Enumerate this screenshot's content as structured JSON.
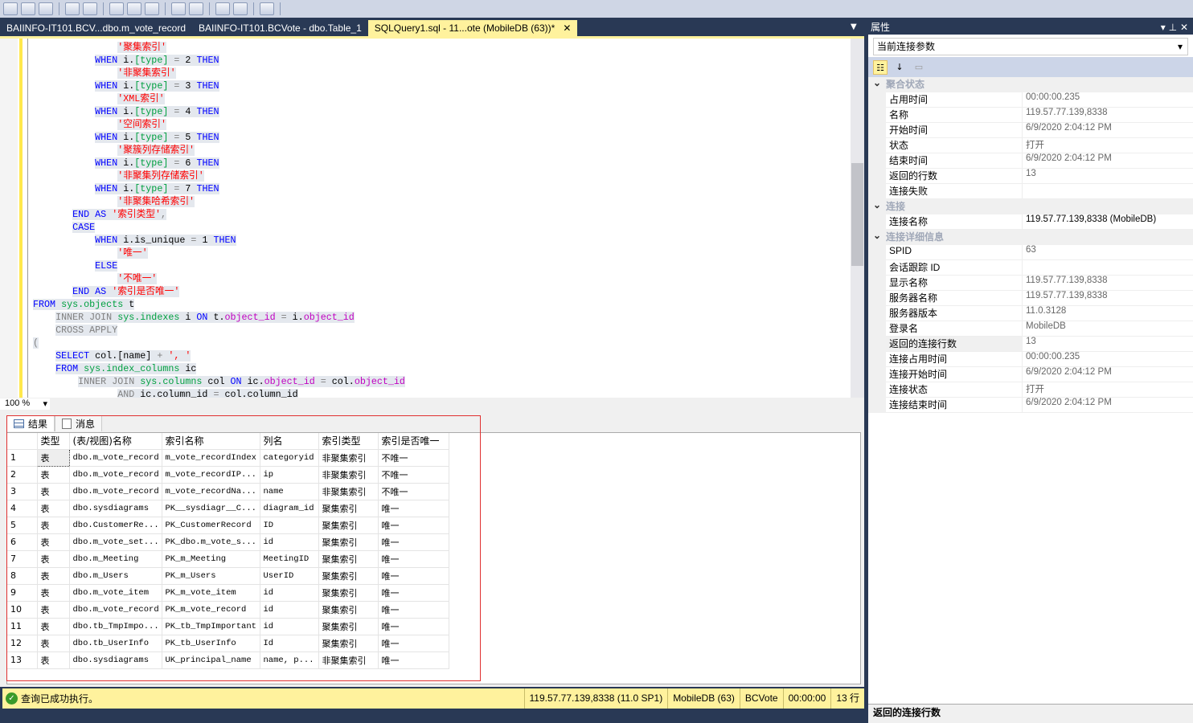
{
  "tabs": [
    {
      "label": "BAIINFO-IT101.BCV...dbo.m_vote_record"
    },
    {
      "label": "BAIINFO-IT101.BCVote - dbo.Table_1"
    },
    {
      "label": "SQLQuery1.sql - 11...ote (MobileDB (63))*",
      "active": true
    }
  ],
  "code": [
    [
      [
        "               ",
        "pl"
      ],
      [
        "'聚集索引'",
        "str"
      ]
    ],
    [
      [
        "           ",
        "pl"
      ],
      [
        "WHEN ",
        "kw"
      ],
      [
        "i.",
        "pl"
      ],
      [
        "[type]",
        "col2"
      ],
      [
        " = ",
        "gray"
      ],
      [
        "2 ",
        "num"
      ],
      [
        "THEN",
        "kw"
      ]
    ],
    [
      [
        "               ",
        "pl"
      ],
      [
        "'非聚集索引'",
        "str"
      ]
    ],
    [
      [
        "           ",
        "pl"
      ],
      [
        "WHEN ",
        "kw"
      ],
      [
        "i.",
        "pl"
      ],
      [
        "[type]",
        "col2"
      ],
      [
        " = ",
        "gray"
      ],
      [
        "3 ",
        "num"
      ],
      [
        "THEN",
        "kw"
      ]
    ],
    [
      [
        "               ",
        "pl"
      ],
      [
        "'XML索引'",
        "str"
      ]
    ],
    [
      [
        "           ",
        "pl"
      ],
      [
        "WHEN ",
        "kw"
      ],
      [
        "i.",
        "pl"
      ],
      [
        "[type]",
        "col2"
      ],
      [
        " = ",
        "gray"
      ],
      [
        "4 ",
        "num"
      ],
      [
        "THEN",
        "kw"
      ]
    ],
    [
      [
        "               ",
        "pl"
      ],
      [
        "'空间索引'",
        "str"
      ]
    ],
    [
      [
        "           ",
        "pl"
      ],
      [
        "WHEN ",
        "kw"
      ],
      [
        "i.",
        "pl"
      ],
      [
        "[type]",
        "col2"
      ],
      [
        " = ",
        "gray"
      ],
      [
        "5 ",
        "num"
      ],
      [
        "THEN",
        "kw"
      ]
    ],
    [
      [
        "               ",
        "pl"
      ],
      [
        "'聚簇列存储索引'",
        "str"
      ]
    ],
    [
      [
        "           ",
        "pl"
      ],
      [
        "WHEN ",
        "kw"
      ],
      [
        "i.",
        "pl"
      ],
      [
        "[type]",
        "col2"
      ],
      [
        " = ",
        "gray"
      ],
      [
        "6 ",
        "num"
      ],
      [
        "THEN",
        "kw"
      ]
    ],
    [
      [
        "               ",
        "pl"
      ],
      [
        "'非聚集列存储索引'",
        "str"
      ]
    ],
    [
      [
        "           ",
        "pl"
      ],
      [
        "WHEN ",
        "kw"
      ],
      [
        "i.",
        "pl"
      ],
      [
        "[type]",
        "col2"
      ],
      [
        " = ",
        "gray"
      ],
      [
        "7 ",
        "num"
      ],
      [
        "THEN",
        "kw"
      ]
    ],
    [
      [
        "               ",
        "pl"
      ],
      [
        "'非聚集哈希索引'",
        "str"
      ]
    ],
    [
      [
        "       ",
        "pl"
      ],
      [
        "END AS ",
        "kw"
      ],
      [
        "'索引类型'",
        "str"
      ],
      [
        ",",
        "gray"
      ]
    ],
    [
      [
        "       ",
        "pl"
      ],
      [
        "CASE",
        "kw"
      ]
    ],
    [
      [
        "           ",
        "pl"
      ],
      [
        "WHEN ",
        "kw"
      ],
      [
        "i.is_unique",
        "pl"
      ],
      [
        " = ",
        "gray"
      ],
      [
        "1 ",
        "num"
      ],
      [
        "THEN",
        "kw"
      ]
    ],
    [
      [
        "               ",
        "pl"
      ],
      [
        "'唯一'",
        "str"
      ]
    ],
    [
      [
        "           ",
        "pl"
      ],
      [
        "ELSE",
        "kw"
      ]
    ],
    [
      [
        "               ",
        "pl"
      ],
      [
        "'不唯一'",
        "str"
      ]
    ],
    [
      [
        "       ",
        "pl"
      ],
      [
        "END AS ",
        "kw"
      ],
      [
        "'索引是否唯一'",
        "str"
      ]
    ],
    [
      [
        "FROM ",
        "kw"
      ],
      [
        "sys.objects",
        "sys"
      ],
      [
        " t",
        "pl"
      ]
    ],
    [
      [
        "    ",
        "pl"
      ],
      [
        "INNER JOIN ",
        "gray"
      ],
      [
        "sys.indexes",
        "sys"
      ],
      [
        " i ",
        "pl"
      ],
      [
        "ON ",
        "kw"
      ],
      [
        "t.",
        "pl"
      ],
      [
        "object_id",
        "col"
      ],
      [
        " = ",
        "gray"
      ],
      [
        "i.",
        "pl"
      ],
      [
        "object_id",
        "col"
      ]
    ],
    [
      [
        "    ",
        "pl"
      ],
      [
        "CROSS APPLY",
        "gray"
      ]
    ],
    [
      [
        "(",
        "gray"
      ]
    ],
    [
      [
        "    ",
        "pl"
      ],
      [
        "SELECT ",
        "kw"
      ],
      [
        "col.",
        "pl"
      ],
      [
        "[name]",
        "pl"
      ],
      [
        " + ",
        "gray"
      ],
      [
        "', '",
        "str"
      ]
    ],
    [
      [
        "    ",
        "pl"
      ],
      [
        "FROM ",
        "kw"
      ],
      [
        "sys.index_columns",
        "sys"
      ],
      [
        " ic",
        "pl"
      ]
    ],
    [
      [
        "        ",
        "pl"
      ],
      [
        "INNER JOIN ",
        "gray"
      ],
      [
        "sys.columns",
        "sys"
      ],
      [
        " col ",
        "pl"
      ],
      [
        "ON ",
        "kw"
      ],
      [
        "ic.",
        "pl"
      ],
      [
        "object_id",
        "col"
      ],
      [
        " = ",
        "gray"
      ],
      [
        "col.",
        "pl"
      ],
      [
        "object_id",
        "col"
      ]
    ],
    [
      [
        "               ",
        "pl"
      ],
      [
        "AND ",
        "gray"
      ],
      [
        "ic.column_id",
        "pl"
      ],
      [
        " = ",
        "gray"
      ],
      [
        "col.column_id",
        "pl"
      ]
    ]
  ],
  "editor": {
    "zoom": "100 %"
  },
  "results": {
    "tabs": [
      {
        "label": "结果",
        "icon": "grid-icon"
      },
      {
        "label": "消息",
        "icon": "message-icon"
      }
    ],
    "columns": [
      "类型",
      "(表/视图)名称",
      "索引名称",
      "列名",
      "索引类型",
      "索引是否唯一"
    ],
    "rows": [
      [
        "1",
        "表",
        "dbo.m_vote_record",
        "m_vote_recordIndex",
        "categoryid",
        "非聚集索引",
        "不唯一"
      ],
      [
        "2",
        "表",
        "dbo.m_vote_record",
        "m_vote_recordIP...",
        "ip",
        "非聚集索引",
        "不唯一"
      ],
      [
        "3",
        "表",
        "dbo.m_vote_record",
        "m_vote_recordNa...",
        "name",
        "非聚集索引",
        "不唯一"
      ],
      [
        "4",
        "表",
        "dbo.sysdiagrams",
        "PK__sysdiagr__C...",
        "diagram_id",
        "聚集索引",
        "唯一"
      ],
      [
        "5",
        "表",
        "dbo.CustomerRe...",
        "PK_CustomerRecord",
        "ID",
        "聚集索引",
        "唯一"
      ],
      [
        "6",
        "表",
        "dbo.m_vote_set...",
        "PK_dbo.m_vote_s...",
        "id",
        "聚集索引",
        "唯一"
      ],
      [
        "7",
        "表",
        "dbo.m_Meeting",
        "PK_m_Meeting",
        "MeetingID",
        "聚集索引",
        "唯一"
      ],
      [
        "8",
        "表",
        "dbo.m_Users",
        "PK_m_Users",
        "UserID",
        "聚集索引",
        "唯一"
      ],
      [
        "9",
        "表",
        "dbo.m_vote_item",
        "PK_m_vote_item",
        "id",
        "聚集索引",
        "唯一"
      ],
      [
        "10",
        "表",
        "dbo.m_vote_record",
        "PK_m_vote_record",
        "id",
        "聚集索引",
        "唯一"
      ],
      [
        "11",
        "表",
        "dbo.tb_TmpImpo...",
        "PK_tb_TmpImportant",
        "id",
        "聚集索引",
        "唯一"
      ],
      [
        "12",
        "表",
        "dbo.tb_UserInfo",
        "PK_tb_UserInfo",
        "Id",
        "聚集索引",
        "唯一"
      ],
      [
        "13",
        "表",
        "dbo.sysdiagrams",
        "UK_principal_name",
        "name, p...",
        "非聚集索引",
        "唯一"
      ]
    ]
  },
  "status": {
    "message": "查询已成功执行。",
    "server": "119.57.77.139,8338 (11.0 SP1)",
    "login": "MobileDB (63)",
    "database": "BCVote",
    "elapsed": "00:00:00",
    "rows": "13 行",
    "color": "#fff29d"
  },
  "properties": {
    "title": "属性",
    "selector": "当前连接参数",
    "sections": [
      {
        "name": "聚合状态",
        "items": [
          [
            "占用时间",
            "00:00:00.235"
          ],
          [
            "名称",
            "119.57.77.139,8338"
          ],
          [
            "开始时间",
            "6/9/2020 2:04:12 PM"
          ],
          [
            "状态",
            "打开"
          ],
          [
            "结束时间",
            "6/9/2020 2:04:12 PM"
          ],
          [
            "返回的行数",
            "13"
          ],
          [
            "连接失败",
            ""
          ]
        ]
      },
      {
        "name": "连接",
        "items": [
          [
            "连接名称",
            "119.57.77.139,8338 (MobileDB)"
          ]
        ]
      },
      {
        "name": "连接详细信息",
        "items": [
          [
            "SPID",
            "63"
          ],
          [
            "会话跟踪 ID",
            ""
          ],
          [
            "显示名称",
            "119.57.77.139,8338"
          ],
          [
            "服务器名称",
            "119.57.77.139,8338"
          ],
          [
            "服务器版本",
            "11.0.3128"
          ],
          [
            "登录名",
            "MobileDB"
          ],
          [
            "返回的连接行数",
            "13"
          ],
          [
            "连接占用时间",
            "00:00:00.235"
          ],
          [
            "连接开始时间",
            "6/9/2020 2:04:12 PM"
          ],
          [
            "连接状态",
            "打开"
          ],
          [
            "连接结束时间",
            "6/9/2020 2:04:12 PM"
          ]
        ]
      }
    ],
    "description": "返回的连接行数"
  }
}
